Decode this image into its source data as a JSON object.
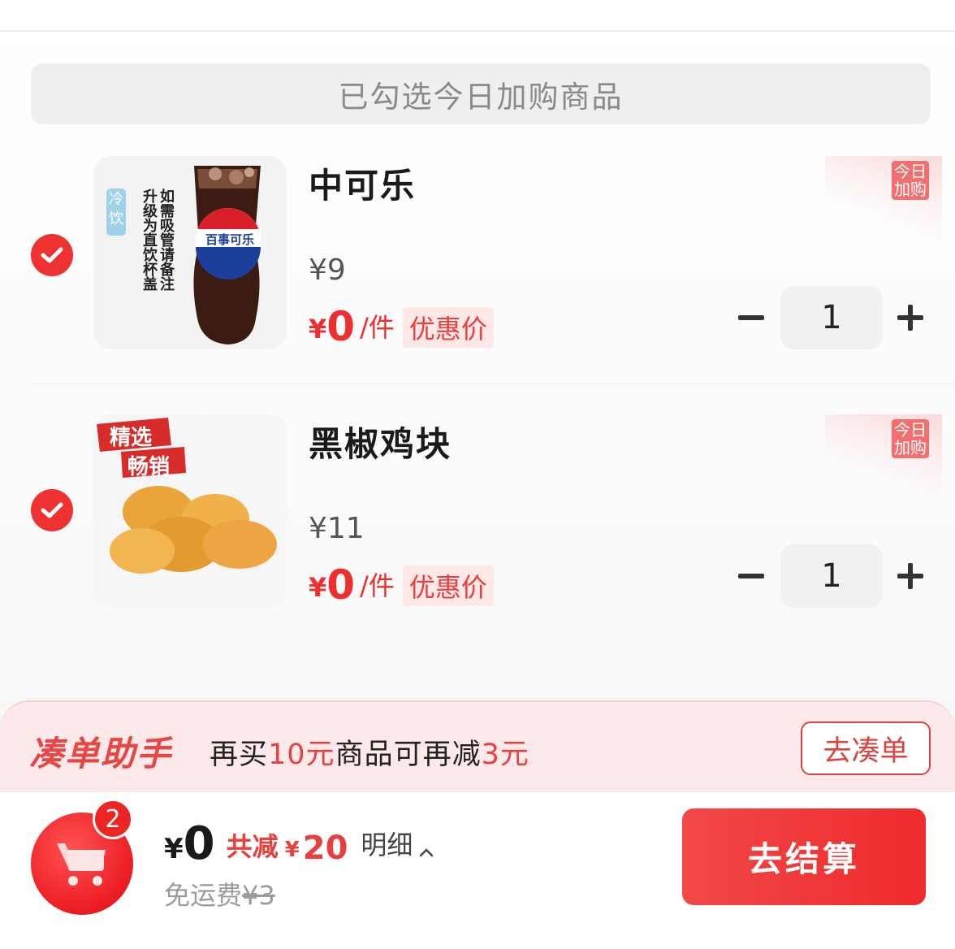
{
  "section_header": "已勾选今日加购商品",
  "items": [
    {
      "name": "中可乐",
      "original_price": "¥9",
      "currency": "¥",
      "deal_price": "0",
      "unit": "/件",
      "promo_tag": "优惠价",
      "quantity": "1",
      "corner_tag": "今日加购",
      "image": {
        "label_cold": "冷饮",
        "note": "如需吸管请备注升级为直饮杯盖",
        "brand": "百事可乐"
      }
    },
    {
      "name": "黑椒鸡块",
      "original_price": "¥11",
      "currency": "¥",
      "deal_price": "0",
      "unit": "/件",
      "promo_tag": "优惠价",
      "quantity": "1",
      "corner_tag": "今日加购",
      "image": {
        "badge_top": "精选",
        "badge_bottom": "畅销"
      }
    }
  ],
  "helper": {
    "title": "凑单助手",
    "text_pre": "再买",
    "text_amount": "10元",
    "text_mid": "商品可再减",
    "text_discount": "3元",
    "button": "去凑单"
  },
  "bottom": {
    "cart_count": "2",
    "currency": "¥",
    "total": "0",
    "save_label": "共减",
    "save_currency": "¥",
    "save_amount": "20",
    "detail": "明细",
    "shipping_label": "免运费",
    "shipping_original": "¥3",
    "checkout": "去结算"
  },
  "colors": {
    "accent": "#ee2f2f",
    "tag_bg": "#fde7e7",
    "helper_bg": "#fde9e9"
  },
  "icons": [
    "check-icon",
    "minus-icon",
    "plus-icon",
    "cart-icon",
    "caret-up-icon"
  ]
}
